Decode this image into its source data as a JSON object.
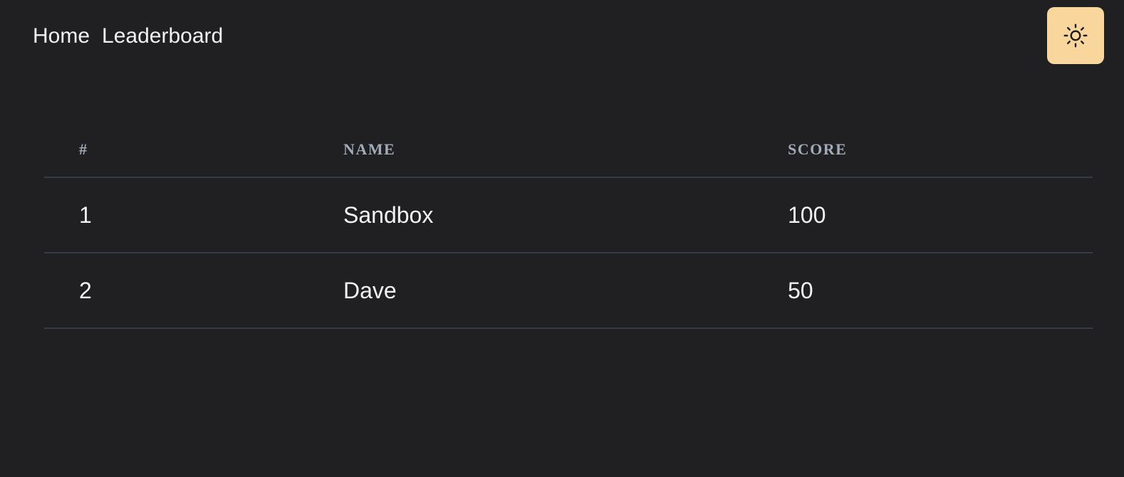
{
  "nav": {
    "items": [
      {
        "label": "Home"
      },
      {
        "label": "Leaderboard"
      }
    ]
  },
  "theme_toggle": {
    "icon": "sun-icon",
    "color": "#f9d69b"
  },
  "leaderboard": {
    "columns": [
      "#",
      "NAME",
      "SCORE"
    ],
    "rows": [
      {
        "rank": "1",
        "name": "Sandbox",
        "score": "100"
      },
      {
        "rank": "2",
        "name": "Dave",
        "score": "50"
      }
    ]
  }
}
